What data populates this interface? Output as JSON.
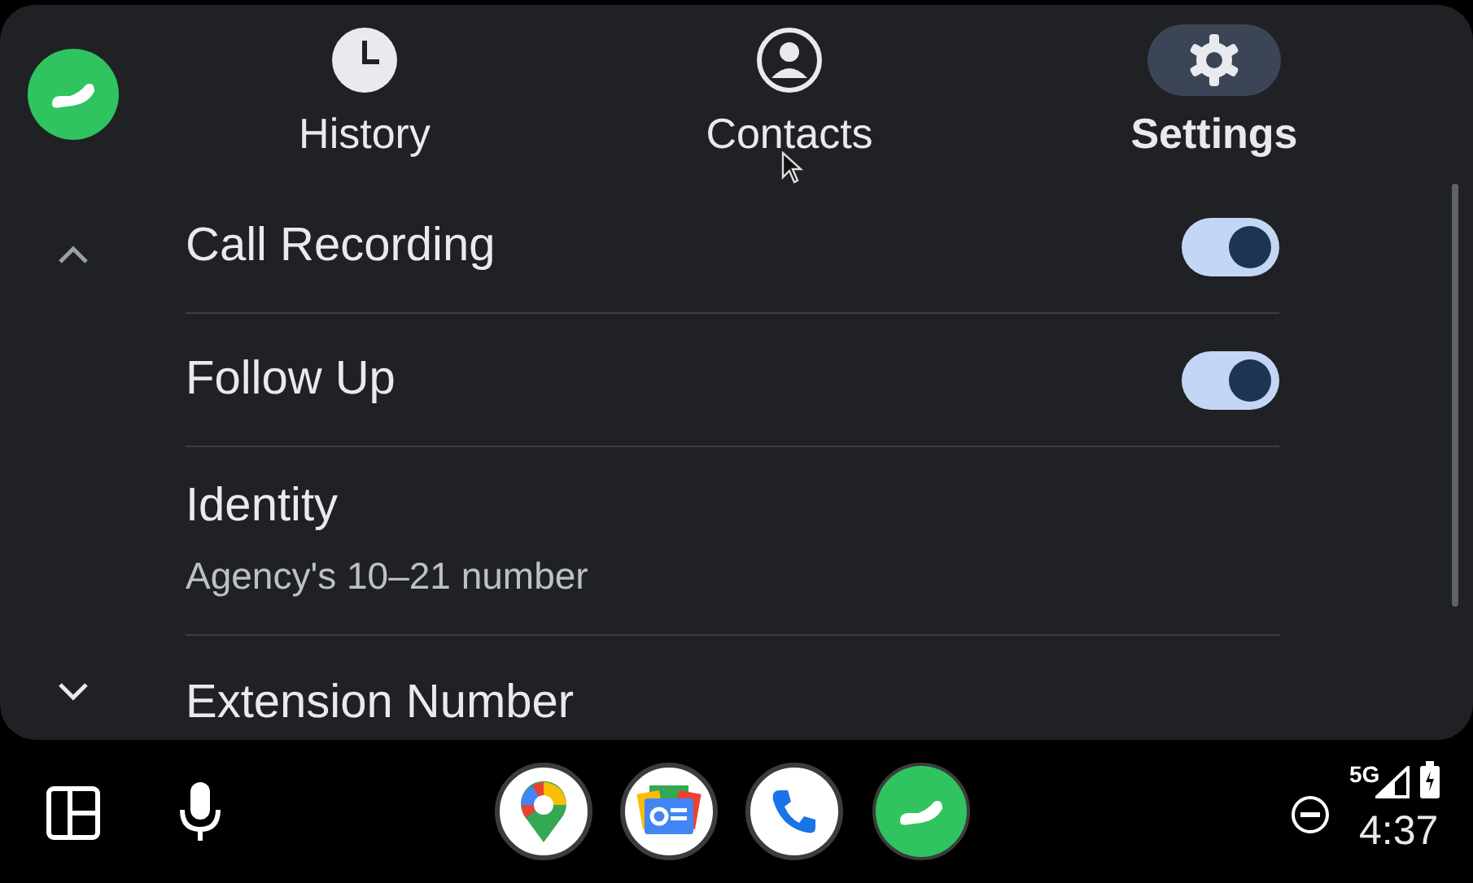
{
  "tabs": [
    {
      "label": "History",
      "kind": "clock",
      "selected": false
    },
    {
      "label": "Contacts",
      "kind": "person",
      "selected": false
    },
    {
      "label": "Settings",
      "kind": "gear",
      "selected": true
    }
  ],
  "settings": [
    {
      "kind": "toggle",
      "title": "Call Recording",
      "on": true
    },
    {
      "kind": "toggle",
      "title": "Follow Up",
      "on": true
    },
    {
      "kind": "text",
      "title": "Identity",
      "subtitle": "Agency's 10–21 number"
    },
    {
      "kind": "text",
      "title": "Extension Number"
    }
  ],
  "dock": [
    {
      "kind": "maps"
    },
    {
      "kind": "news"
    },
    {
      "kind": "phone"
    },
    {
      "kind": "app"
    }
  ],
  "status_bar": {
    "network": "5G",
    "time": "4:37"
  }
}
